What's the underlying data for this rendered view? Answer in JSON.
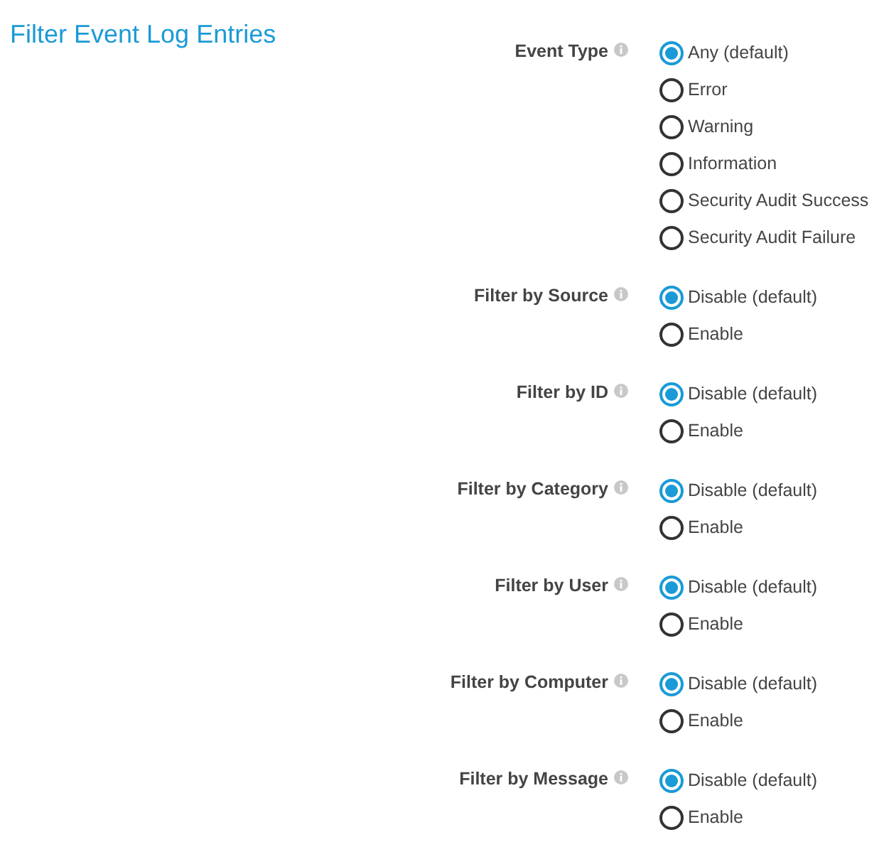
{
  "title": "Filter Event Log Entries",
  "fields": [
    {
      "label": "Event Type",
      "options": [
        {
          "label": "Any (default)",
          "selected": true
        },
        {
          "label": "Error",
          "selected": false
        },
        {
          "label": "Warning",
          "selected": false
        },
        {
          "label": "Information",
          "selected": false
        },
        {
          "label": "Security Audit Success",
          "selected": false
        },
        {
          "label": "Security Audit Failure",
          "selected": false
        }
      ]
    },
    {
      "label": "Filter by Source",
      "options": [
        {
          "label": "Disable (default)",
          "selected": true
        },
        {
          "label": "Enable",
          "selected": false
        }
      ]
    },
    {
      "label": "Filter by ID",
      "options": [
        {
          "label": "Disable (default)",
          "selected": true
        },
        {
          "label": "Enable",
          "selected": false
        }
      ]
    },
    {
      "label": "Filter by Category",
      "options": [
        {
          "label": "Disable (default)",
          "selected": true
        },
        {
          "label": "Enable",
          "selected": false
        }
      ]
    },
    {
      "label": "Filter by User",
      "options": [
        {
          "label": "Disable (default)",
          "selected": true
        },
        {
          "label": "Enable",
          "selected": false
        }
      ]
    },
    {
      "label": "Filter by Computer",
      "options": [
        {
          "label": "Disable (default)",
          "selected": true
        },
        {
          "label": "Enable",
          "selected": false
        }
      ]
    },
    {
      "label": "Filter by Message",
      "options": [
        {
          "label": "Disable (default)",
          "selected": true
        },
        {
          "label": "Enable",
          "selected": false
        }
      ]
    }
  ]
}
